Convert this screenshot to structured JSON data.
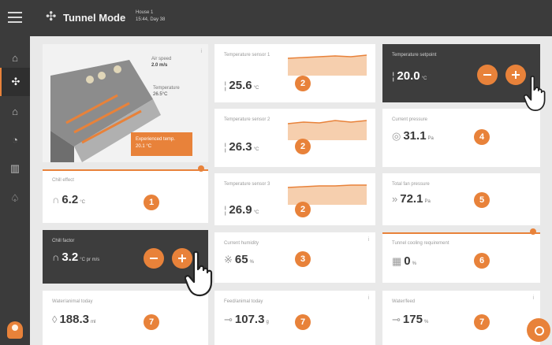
{
  "header": {
    "title": "Tunnel Mode",
    "house_name": "House 1",
    "house_time": "15:44, Day 38"
  },
  "overview": {
    "air_speed_label": "Air speed",
    "air_speed_value": "2.0 m/s",
    "temperature_label": "Temperature",
    "temperature_value": "26.5°C",
    "experienced_label": "Experienced temp.",
    "experienced_value": "20.1 °C"
  },
  "cards": {
    "chill_effect": {
      "label": "Chill effect",
      "value": "6.2",
      "unit": "°C",
      "badge": "1"
    },
    "chill_factor": {
      "label": "Chill factor",
      "value": "3.2",
      "unit": "°C pr m/s"
    },
    "water_animal": {
      "label": "Water/animal today",
      "value": "188.3",
      "unit": "ml",
      "badge": "7"
    },
    "temp_sensor_1": {
      "label": "Temperature sensor 1",
      "value": "25.6",
      "unit": "°C",
      "badge": "2"
    },
    "temp_sensor_2": {
      "label": "Temperature sensor 2",
      "value": "26.3",
      "unit": "°C",
      "badge": "2"
    },
    "temp_sensor_3": {
      "label": "Temperature sensor 3",
      "value": "26.9",
      "unit": "°C",
      "badge": "2"
    },
    "humidity": {
      "label": "Current humidity",
      "value": "65",
      "unit": "%",
      "badge": "3"
    },
    "feed_animal": {
      "label": "Feed/animal today",
      "value": "107.3",
      "unit": "g",
      "badge": "7"
    },
    "setpoint": {
      "label": "Temperature setpoint",
      "value": "20.0",
      "unit": "°C"
    },
    "pressure": {
      "label": "Current pressure",
      "value": "31.1",
      "unit": "Pa",
      "badge": "4"
    },
    "fan_pressure": {
      "label": "Total fan pressure",
      "value": "72.1",
      "unit": "Pa",
      "badge": "5"
    },
    "tunnel_cooling": {
      "label": "Tunnel cooling requirement",
      "value": "0",
      "unit": "%",
      "badge": "6"
    },
    "water_feed": {
      "label": "Water/feed",
      "value": "175",
      "unit": "%",
      "badge": "7"
    }
  },
  "colors": {
    "accent": "#e8823a",
    "dark": "#3b3b3b",
    "card": "#ffffff",
    "background": "#e9e9e9"
  },
  "icons": [
    "menu-icon",
    "fan-icon",
    "home-icon",
    "thermometer-icon",
    "gauge-icon",
    "humidity-icon",
    "drop-icon",
    "feed-icon"
  ]
}
